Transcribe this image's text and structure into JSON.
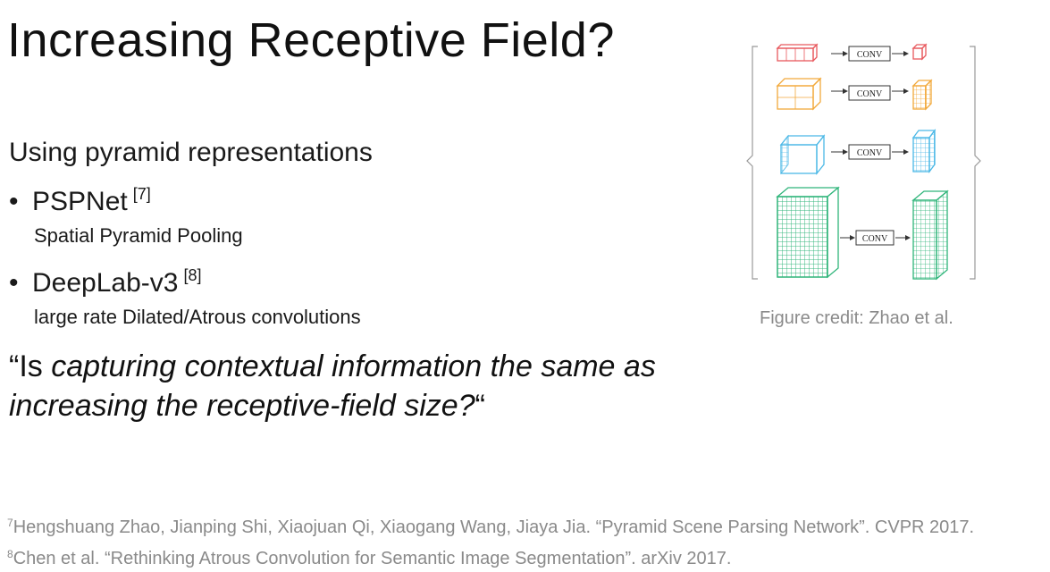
{
  "slide": {
    "title": "Increasing Receptive Field?",
    "subtitle": "Using pyramid representations",
    "bullets": [
      {
        "label": "PSPNet",
        "ref": "[7]",
        "detail": "Spatial Pyramid Pooling"
      },
      {
        "label": "DeepLab-v3",
        "ref": "[8]",
        "detail": "large rate Dilated/Atrous convolutions"
      }
    ],
    "quote": {
      "open": "“Is ",
      "italic_line1": "capturing contextual information the same as",
      "italic_line2": "increasing the receptive-field size?",
      "close": "“"
    }
  },
  "figure": {
    "conv_label": "CONV",
    "caption": "Figure credit: Zhao et al.",
    "colors": {
      "red": "#e8595e",
      "orange": "#f2a93b",
      "blue": "#4bb8e6",
      "green": "#2fb57a"
    }
  },
  "references": [
    {
      "num": "7",
      "text": "Hengshuang Zhao, Jianping Shi, Xiaojuan Qi, Xiaogang Wang, Jiaya Jia. “Pyramid Scene Parsing Network”. CVPR 2017."
    },
    {
      "num": "8",
      "text": "Chen et al.  “Rethinking Atrous Convolution for Semantic Image Segmentation”. arXiv 2017."
    }
  ]
}
